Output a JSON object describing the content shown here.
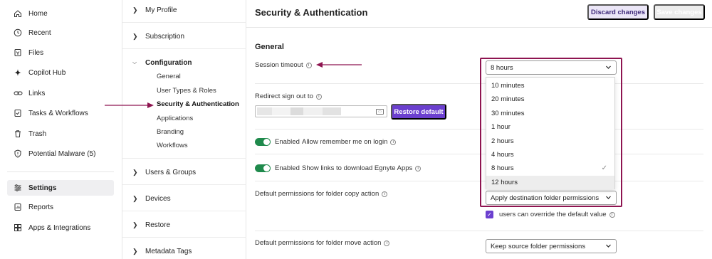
{
  "left_nav": {
    "items": [
      {
        "label": "Home",
        "icon": "home-icon"
      },
      {
        "label": "Recent",
        "icon": "clock-icon"
      },
      {
        "label": "Files",
        "icon": "files-icon"
      },
      {
        "label": "Copilot Hub",
        "icon": "sparkle-icon"
      },
      {
        "label": "Links",
        "icon": "link-icon"
      },
      {
        "label": "Tasks & Workflows",
        "icon": "tasks-icon"
      },
      {
        "label": "Trash",
        "icon": "trash-icon"
      },
      {
        "label": "Potential Malware (5)",
        "icon": "shield-alert-icon"
      },
      {
        "label": "Settings",
        "icon": "sliders-icon",
        "active": true
      },
      {
        "label": "Reports",
        "icon": "reports-icon"
      },
      {
        "label": "Apps & Integrations",
        "icon": "apps-icon"
      }
    ]
  },
  "settings_menu": {
    "sections": [
      {
        "label": "My Profile"
      },
      {
        "label": "Subscription"
      },
      {
        "label": "Configuration",
        "expanded": true
      },
      {
        "label": "Users & Groups"
      },
      {
        "label": "Devices"
      },
      {
        "label": "Restore"
      },
      {
        "label": "Metadata Tags"
      }
    ],
    "config_items": [
      {
        "label": "General"
      },
      {
        "label": "User Types & Roles"
      },
      {
        "label": "Security & Authentication",
        "current": true
      },
      {
        "label": "Applications"
      },
      {
        "label": "Branding"
      },
      {
        "label": "Workflows"
      }
    ]
  },
  "main": {
    "title": "Security & Authentication",
    "discard_label": "Discard changes",
    "save_label": "Save changes",
    "section_heading": "General",
    "session_timeout": {
      "label": "Session timeout",
      "value": "8 hours",
      "options": [
        "10 minutes",
        "20 minutes",
        "30 minutes",
        "1 hour",
        "2 hours",
        "4 hours",
        "8 hours",
        "12 hours"
      ],
      "selected": "8 hours",
      "hovered": "12 hours"
    },
    "redirect": {
      "label": "Redirect sign out to",
      "restore_label": "Restore default"
    },
    "remember_me": {
      "state": "Enabled",
      "label": "Allow remember me on login",
      "on": true
    },
    "download_links": {
      "state": "Enabled",
      "label": "Show links to download Egnyte Apps",
      "on": true
    },
    "copy_action": {
      "label": "Default permissions for folder copy action",
      "value": "Apply destination folder permissions",
      "override_label": "users can override the default value",
      "override_checked": true
    },
    "move_action": {
      "label": "Default permissions for folder move action",
      "value": "Keep source folder permissions"
    }
  },
  "colors": {
    "accent": "#6b3fcf",
    "annotation": "#8e1450",
    "toggle_on": "#1f8a4c"
  }
}
